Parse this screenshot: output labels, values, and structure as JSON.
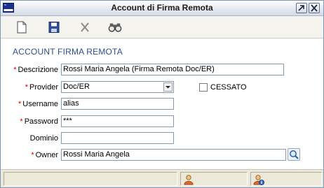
{
  "window": {
    "title": "Account di Firma Remota"
  },
  "title_buttons": {
    "restore_icon": "restore-icon",
    "close_icon": "close-icon"
  },
  "toolbar": {
    "items": [
      "new-document-icon",
      "save-icon",
      "delete-icon",
      "search-binoculars-icon"
    ]
  },
  "form": {
    "section_title": "ACCOUNT FIRMA REMOTA",
    "required_marker": "*",
    "descrizione": {
      "label": "Descrizione",
      "value": "Rossi Maria Angela (Firma Remota Doc/ER)"
    },
    "provider": {
      "label": "Provider",
      "value": "Doc/ER"
    },
    "cessato": {
      "label": "CESSATO",
      "checked": false
    },
    "username": {
      "label": "Username",
      "value": "alias"
    },
    "password": {
      "label": "Password",
      "value": "***"
    },
    "dominio": {
      "label": "Dominio",
      "value": ""
    },
    "owner": {
      "label": "Owner",
      "value": "Rossi Maria Angela"
    }
  },
  "statusbar": {
    "user_icon": "user-icon",
    "user_info_icon": "user-info-icon"
  },
  "colors": {
    "section_title": "#2a4f8e",
    "required": "#cc0000",
    "field_border": "#7f9db9"
  }
}
